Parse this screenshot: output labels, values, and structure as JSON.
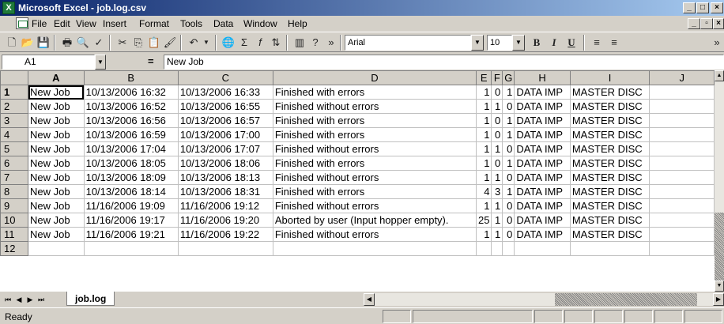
{
  "window": {
    "title": "Microsoft Excel - job.log.csv"
  },
  "menu": [
    "File",
    "Edit",
    "View",
    "Insert",
    "Format",
    "Tools",
    "Data",
    "Window",
    "Help"
  ],
  "toolbar": {
    "font_name": "Arial",
    "font_size": "10"
  },
  "formula_bar": {
    "cell_ref": "A1",
    "content": "New Job"
  },
  "sheet": {
    "columns": [
      "A",
      "B",
      "C",
      "D",
      "E",
      "F",
      "G",
      "H",
      "I",
      "J"
    ],
    "rows": [
      {
        "n": "1",
        "cells": [
          "New Job",
          "10/13/2006 16:32",
          "10/13/2006 16:33",
          "Finished with errors",
          "1",
          "0",
          "1",
          "DATA IMP",
          "MASTER DISC",
          ""
        ]
      },
      {
        "n": "2",
        "cells": [
          "New Job",
          "10/13/2006 16:52",
          "10/13/2006 16:55",
          "Finished without errors",
          "1",
          "1",
          "0",
          "DATA IMP",
          "MASTER DISC",
          ""
        ]
      },
      {
        "n": "3",
        "cells": [
          "New Job",
          "10/13/2006 16:56",
          "10/13/2006 16:57",
          "Finished with errors",
          "1",
          "0",
          "1",
          "DATA IMP",
          "MASTER DISC",
          ""
        ]
      },
      {
        "n": "4",
        "cells": [
          "New Job",
          "10/13/2006 16:59",
          "10/13/2006 17:00",
          "Finished with errors",
          "1",
          "0",
          "1",
          "DATA IMP",
          "MASTER DISC",
          ""
        ]
      },
      {
        "n": "5",
        "cells": [
          "New Job",
          "10/13/2006 17:04",
          "10/13/2006 17:07",
          "Finished without errors",
          "1",
          "1",
          "0",
          "DATA IMP",
          "MASTER DISC",
          ""
        ]
      },
      {
        "n": "6",
        "cells": [
          "New Job",
          "10/13/2006 18:05",
          "10/13/2006 18:06",
          "Finished with errors",
          "1",
          "0",
          "1",
          "DATA IMP",
          "MASTER DISC",
          ""
        ]
      },
      {
        "n": "7",
        "cells": [
          "New Job",
          "10/13/2006 18:09",
          "10/13/2006 18:13",
          "Finished without errors",
          "1",
          "1",
          "0",
          "DATA IMP",
          "MASTER DISC",
          ""
        ]
      },
      {
        "n": "8",
        "cells": [
          "New Job",
          "10/13/2006 18:14",
          "10/13/2006 18:31",
          "Finished with errors",
          "4",
          "3",
          "1",
          "DATA IMP",
          "MASTER DISC",
          ""
        ]
      },
      {
        "n": "9",
        "cells": [
          "New Job",
          "11/16/2006 19:09",
          "11/16/2006 19:12",
          "Finished without errors",
          "1",
          "1",
          "0",
          "DATA IMP",
          "MASTER DISC",
          ""
        ]
      },
      {
        "n": "10",
        "cells": [
          "New Job",
          "11/16/2006 19:17",
          "11/16/2006 19:20",
          "Aborted by user (Input hopper empty).",
          "25",
          "1",
          "0",
          "DATA IMP",
          "MASTER DISC",
          ""
        ]
      },
      {
        "n": "11",
        "cells": [
          "New Job",
          "11/16/2006 19:21",
          "11/16/2006 19:22",
          "Finished without errors",
          "1",
          "1",
          "0",
          "DATA IMP",
          "MASTER DISC",
          ""
        ]
      },
      {
        "n": "12",
        "cells": [
          "",
          "",
          "",
          "",
          "",
          "",
          "",
          "",
          "",
          ""
        ]
      }
    ]
  },
  "sheet_tab": "job.log",
  "status": "Ready"
}
